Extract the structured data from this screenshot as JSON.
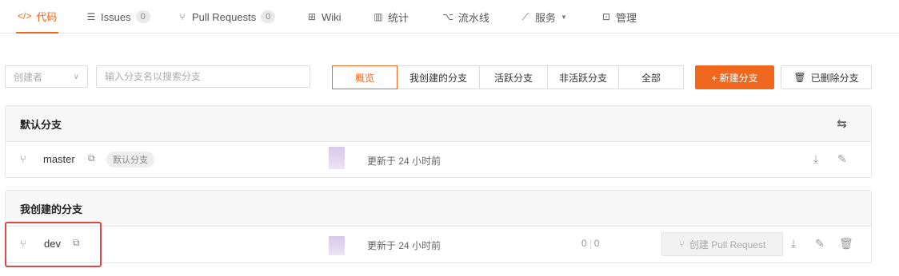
{
  "tabs": [
    {
      "icon": "</>",
      "label": "代码",
      "active": true
    },
    {
      "icon": "☰",
      "label": "Issues",
      "count": "0"
    },
    {
      "icon": "⑂",
      "label": "Pull Requests",
      "count": "0"
    },
    {
      "icon": "⊞",
      "label": "Wiki"
    },
    {
      "icon": "▥",
      "label": "统计"
    },
    {
      "icon": "⌥",
      "label": "流水线"
    },
    {
      "icon": "⟋",
      "label": "服务",
      "dropdown": true
    },
    {
      "icon": "⊡",
      "label": "管理"
    }
  ],
  "filters": {
    "creator_placeholder": "创建者",
    "search_placeholder": "输入分支名以搜索分支",
    "segments": [
      "概览",
      "我创建的分支",
      "活跃分支",
      "非活跃分支",
      "全部"
    ],
    "active_segment": "概览",
    "new_branch": "+ 新建分支",
    "deleted_branches": "已删除分支"
  },
  "sections": {
    "default": {
      "title": "默认分支",
      "branch": {
        "name": "master",
        "badge": "默认分支",
        "updated": "更新于 24 小时前"
      }
    },
    "mine": {
      "title": "我创建的分支",
      "branch": {
        "name": "dev",
        "updated": "更新于 24 小时前",
        "ahead": "0",
        "behind": "0",
        "pr_button": "创建 Pull Request"
      }
    }
  },
  "colors": {
    "accent": "#f0681e",
    "highlight": "#d84a4a"
  }
}
